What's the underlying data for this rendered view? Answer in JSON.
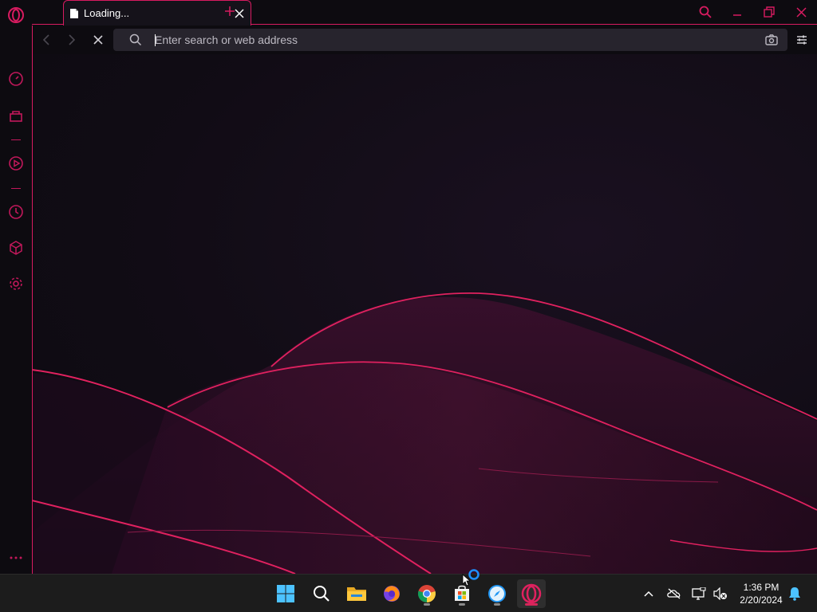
{
  "browser": {
    "tab": {
      "title": "Loading..."
    },
    "address_bar": {
      "placeholder": "Enter search or web address",
      "value": ""
    }
  },
  "sidebar": {
    "items": [
      {
        "name": "speed-dial",
        "icon": "gauge-icon"
      },
      {
        "name": "extensions",
        "icon": "bag-icon"
      },
      {
        "name": "player",
        "icon": "play-icon"
      },
      {
        "name": "history",
        "icon": "clock-icon"
      },
      {
        "name": "extensions-cube",
        "icon": "cube-icon"
      },
      {
        "name": "settings",
        "icon": "gear-icon"
      },
      {
        "name": "more",
        "icon": "ellipsis-icon"
      }
    ]
  },
  "taskbar": {
    "apps": [
      {
        "name": "start",
        "icon": "windows-icon"
      },
      {
        "name": "search",
        "icon": "search-icon"
      },
      {
        "name": "file-explorer",
        "icon": "folder-icon"
      },
      {
        "name": "firefox",
        "icon": "firefox-icon"
      },
      {
        "name": "chrome",
        "icon": "chrome-icon"
      },
      {
        "name": "microsoft-store",
        "icon": "store-icon"
      },
      {
        "name": "safari-like",
        "icon": "compass-icon"
      },
      {
        "name": "opera-gx",
        "icon": "opera-icon"
      }
    ],
    "clock": {
      "time": "1:36 PM",
      "date": "2/20/2024"
    }
  },
  "colors": {
    "accent": "#d81b60",
    "accent_bright": "#ff2a6d",
    "background": "#0d0b10",
    "taskbar": "#1c1c1c"
  }
}
